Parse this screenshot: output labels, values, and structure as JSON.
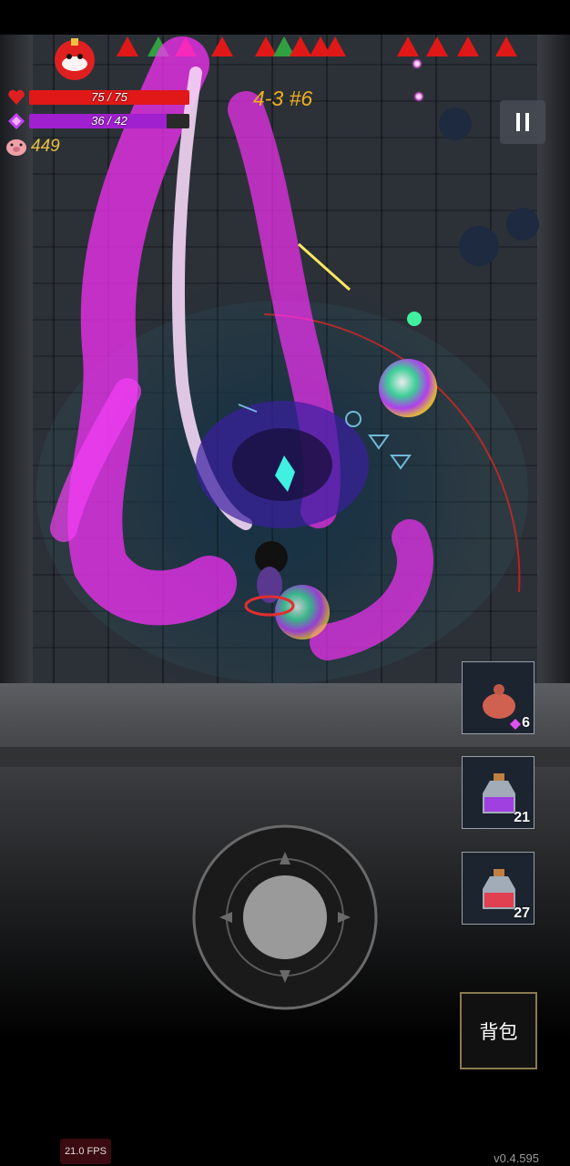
{
  "hud": {
    "hp": {
      "current": 75,
      "max": 75,
      "text": "75 / 75",
      "color": "#e01818"
    },
    "mp": {
      "current": 36,
      "max": 42,
      "text": "36 / 42",
      "color": "#a020d0"
    },
    "coins": "449",
    "level": "4-3 #6"
  },
  "inventory": {
    "slots": [
      {
        "item": "pink-orb",
        "count": "6"
      },
      {
        "item": "purple-potion",
        "count": "21"
      },
      {
        "item": "red-potion",
        "count": "27"
      }
    ]
  },
  "controls": {
    "bag_label": "背包"
  },
  "debug": {
    "fps": "21.0 FPS",
    "version": "v0.4.595"
  },
  "colors": {
    "magic": "#ff30ff",
    "gold": "#f0b020",
    "accent_red": "#e01818"
  }
}
